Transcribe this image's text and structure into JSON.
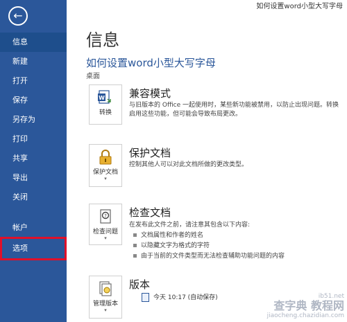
{
  "window": {
    "title": "如何设置word小型大写字母"
  },
  "sidebar": {
    "items": [
      {
        "label": "信息"
      },
      {
        "label": "新建"
      },
      {
        "label": "打开"
      },
      {
        "label": "保存"
      },
      {
        "label": "另存为"
      },
      {
        "label": "打印"
      },
      {
        "label": "共享"
      },
      {
        "label": "导出"
      },
      {
        "label": "关闭"
      },
      {
        "label": "帐户"
      },
      {
        "label": "选项"
      }
    ]
  },
  "main": {
    "title": "信息",
    "doc_title": "如何设置word小型大写字母",
    "doc_location": "桌面",
    "compat": {
      "tile_label": "转换",
      "heading": "兼容模式",
      "desc_line1": "与旧版本的 Office 一起使用时，某些新功能被禁用，以防止出现问题。转换",
      "desc_line2": "启用这些功能，但可能会导致布局更改。"
    },
    "protect": {
      "tile_label": "保护文档",
      "heading": "保护文档",
      "desc": "控制其他人可以对此文档所做的更改类型。"
    },
    "inspect": {
      "tile_label": "检查问题",
      "heading": "检查文档",
      "desc": "在发布此文件之前，请注意其包含以下内容:",
      "bullets": [
        "文档属性和作者的姓名",
        "以隐藏文字为格式的字符",
        "由于当前的文件类型而无法检查辅助功能问题的内容"
      ]
    },
    "versions": {
      "tile_label": "管理版本",
      "heading": "版本",
      "entry": "今天 10:17 (自动保存)"
    }
  },
  "watermark": {
    "line1": "ib51.net",
    "line2": "查字典 教程网",
    "line3": "jiaocheng.chazidian.com"
  },
  "colors": {
    "sidebar": "#2b579a",
    "accent": "#2b579a",
    "highlight_border": "#e0102a"
  }
}
